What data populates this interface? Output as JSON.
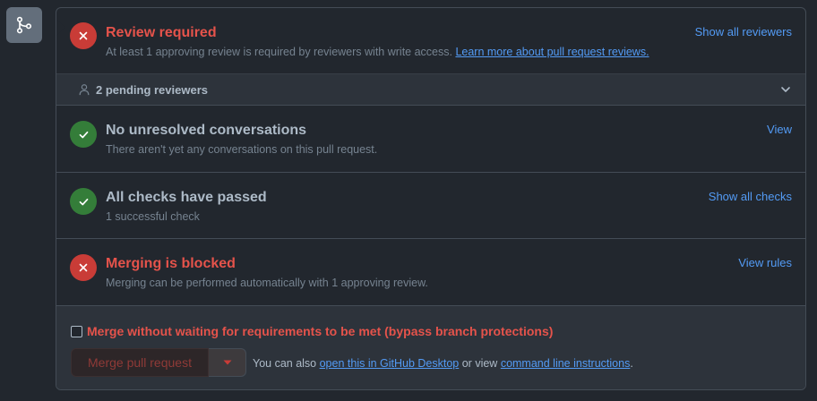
{
  "review": {
    "title": "Review required",
    "description": "At least 1 approving review is required by reviewers with write access.",
    "learn_more": "Learn more about pull request reviews.",
    "action": "Show all reviewers"
  },
  "pending": {
    "label": "2 pending reviewers"
  },
  "conversations": {
    "title": "No unresolved conversations",
    "description": "There aren't yet any conversations on this pull request.",
    "action": "View"
  },
  "checks": {
    "title": "All checks have passed",
    "description": "1 successful check",
    "action": "Show all checks"
  },
  "merging": {
    "title": "Merging is blocked",
    "description": "Merging can be performed automatically with 1 approving review.",
    "action": "View rules"
  },
  "footer": {
    "bypass_label": "Merge without waiting for requirements to be met (bypass branch protections)",
    "bypass_checked": false,
    "merge_button": "Merge pull request",
    "prefix": "You can also",
    "desktop_link": "open this in GitHub Desktop",
    "middle": "or view",
    "cli_link": "command line instructions",
    "suffix": "."
  },
  "colors": {
    "danger": "#e5534b",
    "success": "#347d39",
    "link": "#539bf5"
  }
}
